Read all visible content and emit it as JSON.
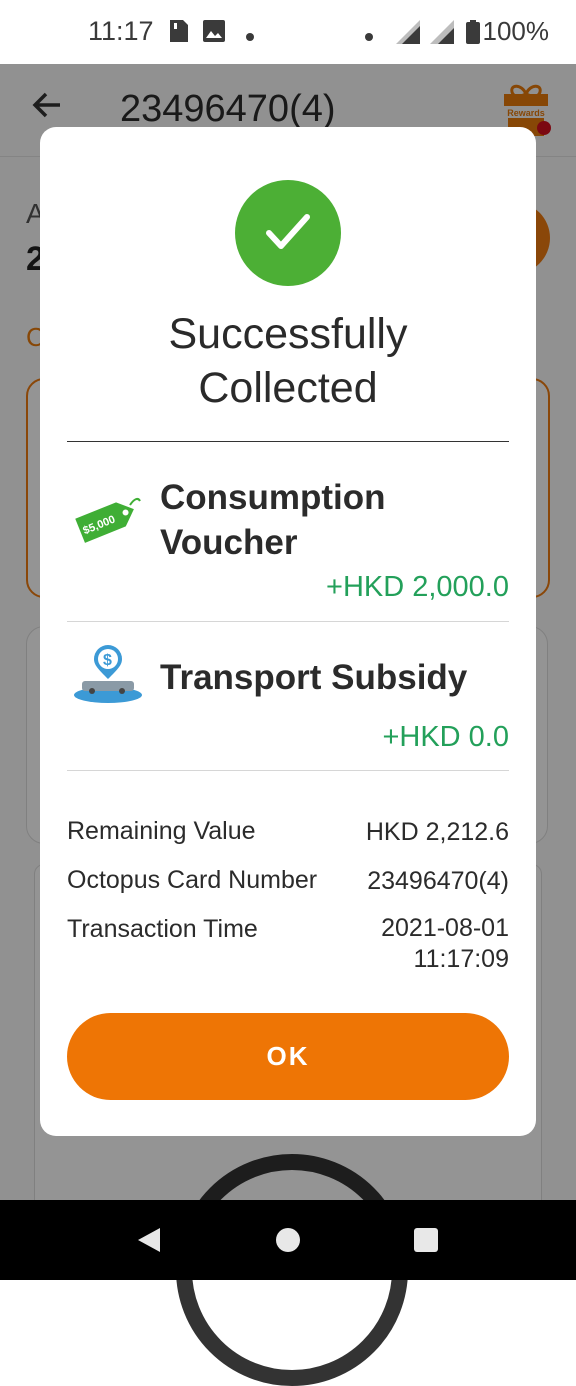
{
  "status_bar": {
    "time": "11:17",
    "battery": "100%"
  },
  "app_bar": {
    "title": "23496470(4)",
    "rewards_label": "Rewards"
  },
  "dialog": {
    "title": "Successfully Collected",
    "benefits": [
      {
        "name": "Consumption Voucher",
        "amount": "+HKD 2,000.0",
        "icon": "voucher-tag-icon",
        "icon_text": "$5,000"
      },
      {
        "name": "Transport Subsidy",
        "amount": "+HKD 0.0",
        "icon": "transport-subsidy-icon"
      }
    ],
    "details": [
      {
        "label": "Remaining Value",
        "value": "HKD 2,212.6"
      },
      {
        "label": "Octopus Card Number",
        "value": "23496470(4)"
      },
      {
        "label": "Transaction Time",
        "value": "2021-08-01\n11:17:09"
      }
    ],
    "ok_label": "OK"
  },
  "colors": {
    "accent_orange": "#ee7505",
    "success_green": "#4caf35",
    "amount_green": "#23a05a"
  }
}
